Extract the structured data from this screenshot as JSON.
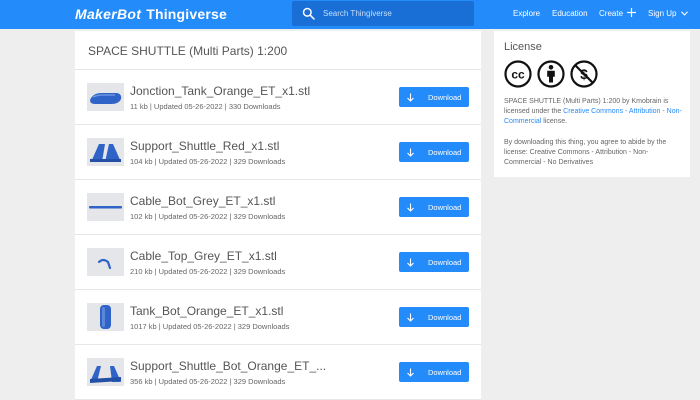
{
  "header": {
    "logo_part1": "MakerBot",
    "logo_part2": "Thingiverse",
    "search_placeholder": "Search Thingiverse",
    "nav": {
      "explore": "Explore",
      "education": "Education",
      "create": "Create",
      "signup": "Sign Up"
    }
  },
  "thing": {
    "title": "SPACE SHUTTLE (Multi Parts) 1:200",
    "download_label": "Download",
    "files": [
      {
        "name": "Jonction_Tank_Orange_ET_x1.stl",
        "meta": "11 kb | Updated 05-26-2022 | 330 Downloads"
      },
      {
        "name": "Support_Shuttle_Red_x1.stl",
        "meta": "104 kb | Updated 05-26-2022 | 329 Downloads"
      },
      {
        "name": "Cable_Bot_Grey_ET_x1.stl",
        "meta": "102 kb | Updated 05-26-2022 | 329 Downloads"
      },
      {
        "name": "Cable_Top_Grey_ET_x1.stl",
        "meta": "210 kb | Updated 05-26-2022 | 329 Downloads"
      },
      {
        "name": "Tank_Bot_Orange_ET_x1.stl",
        "meta": "1017 kb | Updated 05-26-2022 | 329 Downloads"
      },
      {
        "name": "Support_Shuttle_Bot_Orange_ET_...",
        "meta": "356 kb | Updated 05-26-2022 | 329 Downloads"
      }
    ]
  },
  "license": {
    "title": "License",
    "icons": [
      "cc-icon",
      "attribution-icon",
      "non-commercial-icon"
    ],
    "text_prefix": "SPACE SHUTTLE (Multi Parts) 1:200 by Kmobrain is licensed under the",
    "link": "Creative Commons - Attribution - Non-Commercial",
    "text_suffix": "license.",
    "note": "By downloading this thing, you agree to abide by the license: Creative Commons - Attribution - Non-Commercial - No Derivatives"
  },
  "colors": {
    "brand": "#248bfb",
    "search_bg": "#196fd6",
    "thumb_model": "#2f63c7"
  }
}
